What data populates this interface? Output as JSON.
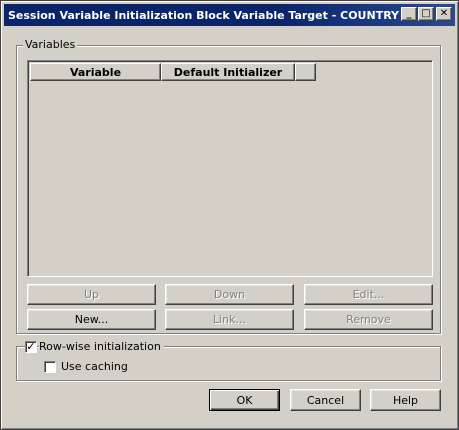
{
  "window": {
    "title": "Session Variable Initialization Block Variable Target - COUNTRY",
    "title_buttons": {
      "minimize": "_",
      "maximize": "□",
      "close": "✕"
    }
  },
  "variables_group": {
    "label": "Variables",
    "columns": [
      "Variable",
      "Default Initializer",
      ""
    ],
    "rows": []
  },
  "list_buttons": {
    "up": "Up",
    "down": "Down",
    "edit": "Edit...",
    "new": "New...",
    "link": "Link...",
    "remove": "Remove"
  },
  "options": {
    "row_wise_label": "Row-wise initialization",
    "row_wise_checked": true,
    "caching_label": "Use caching",
    "caching_checked": false,
    "check_glyph": "✓"
  },
  "dialog_buttons": {
    "ok": "OK",
    "cancel": "Cancel",
    "help": "Help"
  },
  "colors": {
    "title_bar": "#0a246a",
    "face": "#d4d0c8",
    "disabled_text": "#808080"
  }
}
